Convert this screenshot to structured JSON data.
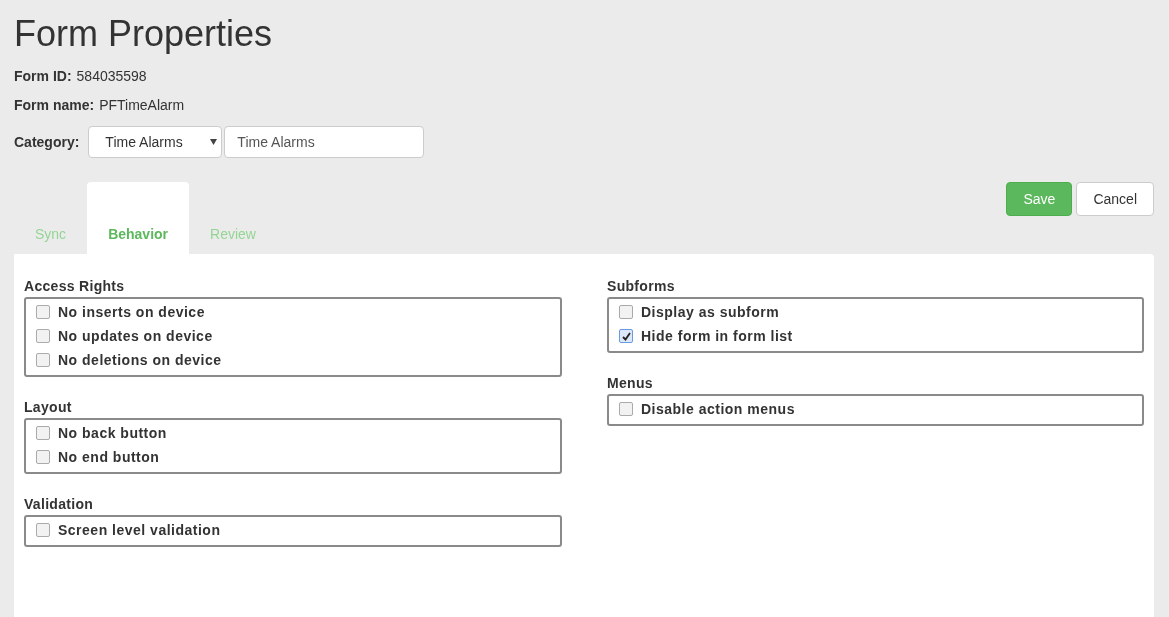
{
  "title": "Form Properties",
  "info": [
    {
      "label": "Form ID:",
      "value": "584035598"
    },
    {
      "label": "Form name:",
      "value": "PFTimeAlarm"
    }
  ],
  "category": {
    "label": "Category:",
    "select": "Time Alarms",
    "input": "Time Alarms"
  },
  "tabs": [
    {
      "label": "Sync",
      "selected": false
    },
    {
      "label": "Behavior",
      "selected": true
    },
    {
      "label": "Review",
      "selected": false
    }
  ],
  "buttons": [
    {
      "label": "Save",
      "kind": "primary"
    },
    {
      "label": "Cancel",
      "kind": "default"
    }
  ],
  "columns": [
    {
      "groups": [
        {
          "title": "Access Rights",
          "options": [
            {
              "label": "No inserts on device",
              "checked": false
            },
            {
              "label": "No updates on device",
              "checked": false
            },
            {
              "label": "No deletions on device",
              "checked": false
            }
          ]
        },
        {
          "title": "Layout",
          "options": [
            {
              "label": "No back button",
              "checked": false
            },
            {
              "label": "No end button",
              "checked": false
            }
          ]
        },
        {
          "title": "Validation",
          "options": [
            {
              "label": "Screen level validation",
              "checked": false
            }
          ]
        }
      ]
    },
    {
      "groups": [
        {
          "title": "Subforms",
          "options": [
            {
              "label": "Display as subform",
              "checked": false
            },
            {
              "label": "Hide form in form list",
              "checked": true
            }
          ]
        },
        {
          "title": "Menus",
          "options": [
            {
              "label": "Disable action menus",
              "checked": false
            }
          ]
        }
      ]
    }
  ]
}
